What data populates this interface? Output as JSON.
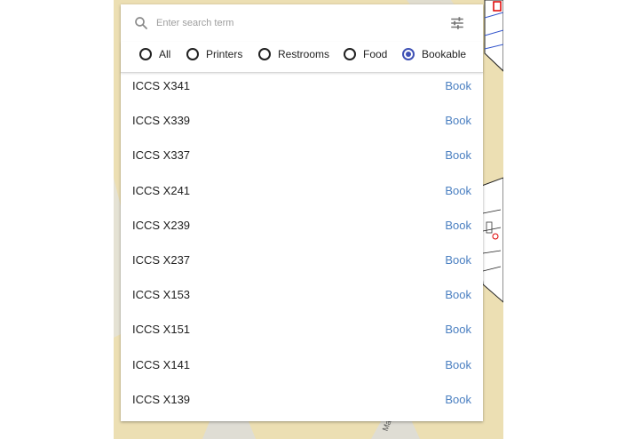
{
  "search": {
    "placeholder": "Enter search term",
    "value": "",
    "icon": "search-icon",
    "filter_icon": "tune-icon"
  },
  "filters": [
    {
      "label": "All",
      "checked": false
    },
    {
      "label": "Printers",
      "checked": false
    },
    {
      "label": "Restrooms",
      "checked": false
    },
    {
      "label": "Food",
      "checked": false
    },
    {
      "label": "Bookable",
      "checked": true
    }
  ],
  "rooms": [
    {
      "name": "ICCS X341",
      "action": "Book"
    },
    {
      "name": "ICCS X339",
      "action": "Book"
    },
    {
      "name": "ICCS X337",
      "action": "Book"
    },
    {
      "name": "ICCS X241",
      "action": "Book"
    },
    {
      "name": "ICCS X239",
      "action": "Book"
    },
    {
      "name": "ICCS X237",
      "action": "Book"
    },
    {
      "name": "ICCS X153",
      "action": "Book"
    },
    {
      "name": "ICCS X151",
      "action": "Book"
    },
    {
      "name": "ICCS X141",
      "action": "Book"
    },
    {
      "name": "ICCS X139",
      "action": "Book"
    }
  ],
  "map": {
    "street_label": "Mall"
  },
  "colors": {
    "accent": "#3f51b5",
    "link": "#4a7fc1",
    "map_background": "#ecdfb3"
  }
}
